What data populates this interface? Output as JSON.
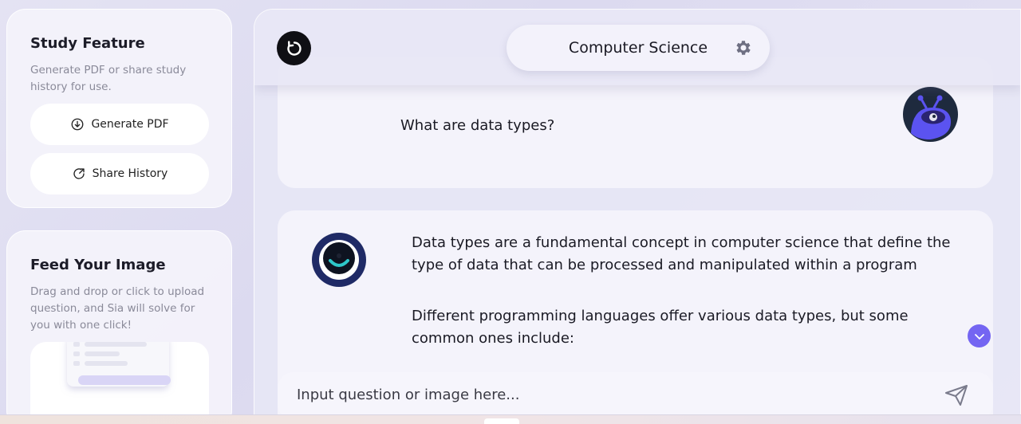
{
  "sidebar": {
    "study": {
      "title": "Study Feature",
      "description": "Generate PDF or share study history for use.",
      "generate_pdf_label": "Generate PDF",
      "share_history_label": "Share History"
    },
    "feed": {
      "title": "Feed Your Image",
      "description": "Drag and drop or click to upload question, and Sia will solve for you with one click!"
    }
  },
  "header": {
    "subject": "Computer Science",
    "icons": [
      "refresh-icon",
      "gear-icon"
    ]
  },
  "chat": {
    "user_message": "What are data types?",
    "ai_paragraphs": [
      "Data types are a fundamental concept in computer science that define the type of data that can be processed and manipulated within a program",
      "Different programming languages offer various data types, but some common ones include:"
    ]
  },
  "composer": {
    "placeholder": "Input question or image here..."
  },
  "colors": {
    "accent": "#7465f2",
    "bot_avatar_bg": "#1e2a3e",
    "ai_avatar_ring": "#1f2a66"
  }
}
